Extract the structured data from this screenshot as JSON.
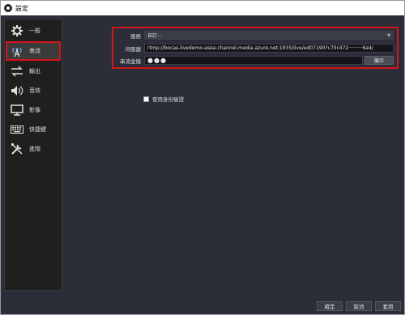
{
  "window": {
    "title": "設定"
  },
  "sidebar": {
    "items": [
      {
        "label": "一般",
        "icon": "gear-icon"
      },
      {
        "label": "串流",
        "icon": "broadcast-icon",
        "active": true
      },
      {
        "label": "輸出",
        "icon": "output-icon"
      },
      {
        "label": "音效",
        "icon": "speaker-icon"
      },
      {
        "label": "影像",
        "icon": "monitor-icon"
      },
      {
        "label": "快捷鍵",
        "icon": "keyboard-icon"
      },
      {
        "label": "進階",
        "icon": "tools-icon"
      }
    ]
  },
  "stream": {
    "service_label": "服務",
    "service_value": "自訂⋯",
    "server_label": "伺服器",
    "server_value": "rtmp://bocas-livedemo-asea.channel.media.azure.net:1935/live/ed07190?c70c472·········6a4/",
    "key_label": "串流金鑰",
    "key_value": "●●●",
    "show_button": "顯示",
    "auth_checkbox_label": "使用身份驗證",
    "auth_checked": false
  },
  "footer": {
    "ok": "確定",
    "cancel": "取消",
    "apply": "套用"
  },
  "colors": {
    "highlight": "#d6141b",
    "panel_bg": "#2b2e38",
    "sidebar_bg": "#1f1f1f"
  }
}
